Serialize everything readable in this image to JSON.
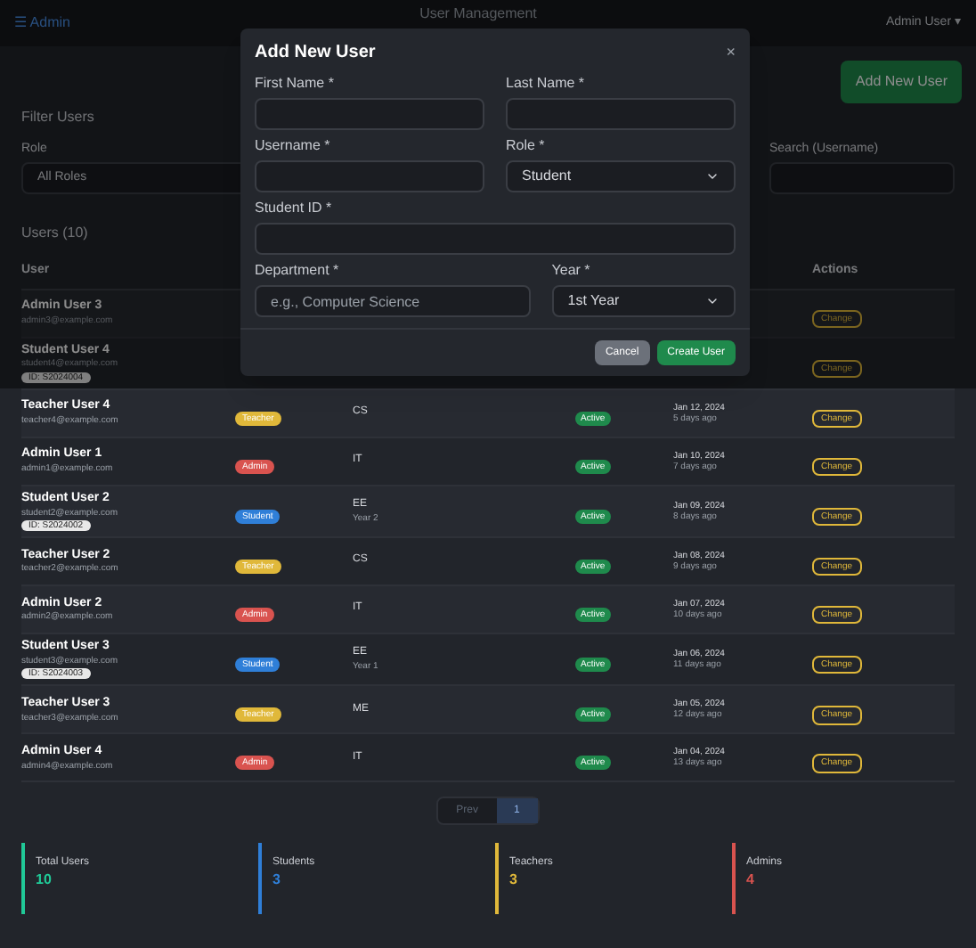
{
  "topbar": {
    "brand": "☰ Admin",
    "title": "User Management",
    "user": "Admin User ▾"
  },
  "add_button": "Add New User",
  "filters": {
    "title": "Filter Users",
    "role_label": "Role",
    "role_value": "All Roles",
    "search_label": "Search (Username)"
  },
  "users_title": "Users (10)",
  "columns": [
    "User",
    "Actions"
  ],
  "rows": [
    {
      "name": "Admin User 3",
      "email": "admin3@example.com",
      "action": "Change"
    },
    {
      "name": "Student User 4",
      "email": "student4@example.com",
      "tag": "ID: S2024004",
      "action": "Change"
    },
    {
      "name": "Teacher User 4",
      "email": "teacher4@example.com",
      "role": "Teacher",
      "color": "#e0b83a",
      "dept": "CS",
      "status": "Active",
      "date": "Jan 12, 2024",
      "ago": "5 days ago",
      "action": "Change"
    },
    {
      "name": "Admin User 1",
      "email": "admin1@example.com",
      "role": "Admin",
      "color": "#d9534f",
      "dept": "IT",
      "status": "Active",
      "date": "Jan 10, 2024",
      "ago": "7 days ago",
      "action": "Change"
    },
    {
      "name": "Student User 2",
      "email": "student2@example.com",
      "role": "Student",
      "color": "#2f7fd8",
      "dept": "EE",
      "year": "Year 2",
      "tag": "ID: S2024002",
      "status": "Active",
      "date": "Jan 09, 2024",
      "ago": "8 days ago",
      "action": "Change"
    },
    {
      "name": "Teacher User 2",
      "email": "teacher2@example.com",
      "role": "Teacher",
      "color": "#e0b83a",
      "dept": "CS",
      "status": "Active",
      "date": "Jan 08, 2024",
      "ago": "9 days ago",
      "action": "Change"
    },
    {
      "name": "Admin User 2",
      "email": "admin2@example.com",
      "role": "Admin",
      "color": "#d9534f",
      "dept": "IT",
      "status": "Active",
      "date": "Jan 07, 2024",
      "ago": "10 days ago",
      "action": "Change"
    },
    {
      "name": "Student User 3",
      "email": "student3@example.com",
      "role": "Student",
      "color": "#2f7fd8",
      "dept": "EE",
      "year": "Year 1",
      "tag": "ID: S2024003",
      "status": "Active",
      "date": "Jan 06, 2024",
      "ago": "11 days ago",
      "action": "Change"
    },
    {
      "name": "Teacher User 3",
      "email": "teacher3@example.com",
      "role": "Teacher",
      "color": "#e0b83a",
      "dept": "ME",
      "status": "Active",
      "date": "Jan 05, 2024",
      "ago": "12 days ago",
      "action": "Change"
    },
    {
      "name": "Admin User 4",
      "email": "admin4@example.com",
      "role": "Admin",
      "color": "#d9534f",
      "dept": "IT",
      "status": "Active",
      "date": "Jan 04, 2024",
      "ago": "13 days ago",
      "action": "Change"
    }
  ],
  "pagination": [
    {
      "label": "Prev",
      "selected": false
    },
    {
      "label": "1",
      "selected": true
    }
  ],
  "stats": [
    {
      "label": "Total Users",
      "value": "10",
      "color": "#20c997"
    },
    {
      "label": "Students",
      "value": "3",
      "color": "#2f7fd8"
    },
    {
      "label": "Teachers",
      "value": "3",
      "color": "#e0b83a"
    },
    {
      "label": "Admins",
      "value": "4",
      "color": "#d9534f"
    }
  ],
  "modal": {
    "title": "Add New User",
    "close": "×",
    "fields": [
      {
        "label": "First Name *",
        "kind": "input"
      },
      {
        "label": "Last Name *",
        "kind": "input"
      },
      {
        "label": "Username *",
        "kind": "input"
      },
      {
        "label": "Role *",
        "kind": "select",
        "value": "Student"
      },
      {
        "label": "Student ID *",
        "kind": "input"
      },
      {
        "label": "Department *",
        "kind": "input",
        "placeholder": "e.g., Computer Science"
      },
      {
        "label": "Year *",
        "kind": "select",
        "value": "1st Year"
      }
    ],
    "cancel": "Cancel",
    "submit": "Create User"
  }
}
